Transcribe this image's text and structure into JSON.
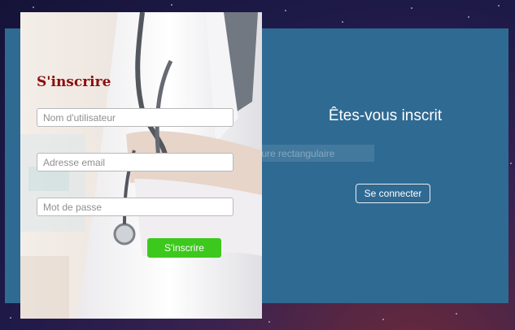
{
  "login_panel": {
    "title": "Êtes-vous inscrit",
    "connect_label": "Se connecter"
  },
  "capture_overlay": {
    "label": "Capture rectangulaire"
  },
  "signup_form": {
    "title": "S'inscrire",
    "username_placeholder": "Nom d'utilisateur",
    "email_placeholder": "Adresse email",
    "password_placeholder": "Mot de passe",
    "submit_label": "S'inscrire"
  },
  "colors": {
    "panel": "#2f6a93",
    "submit": "#3dc81e",
    "title": "#8b0e0e"
  }
}
